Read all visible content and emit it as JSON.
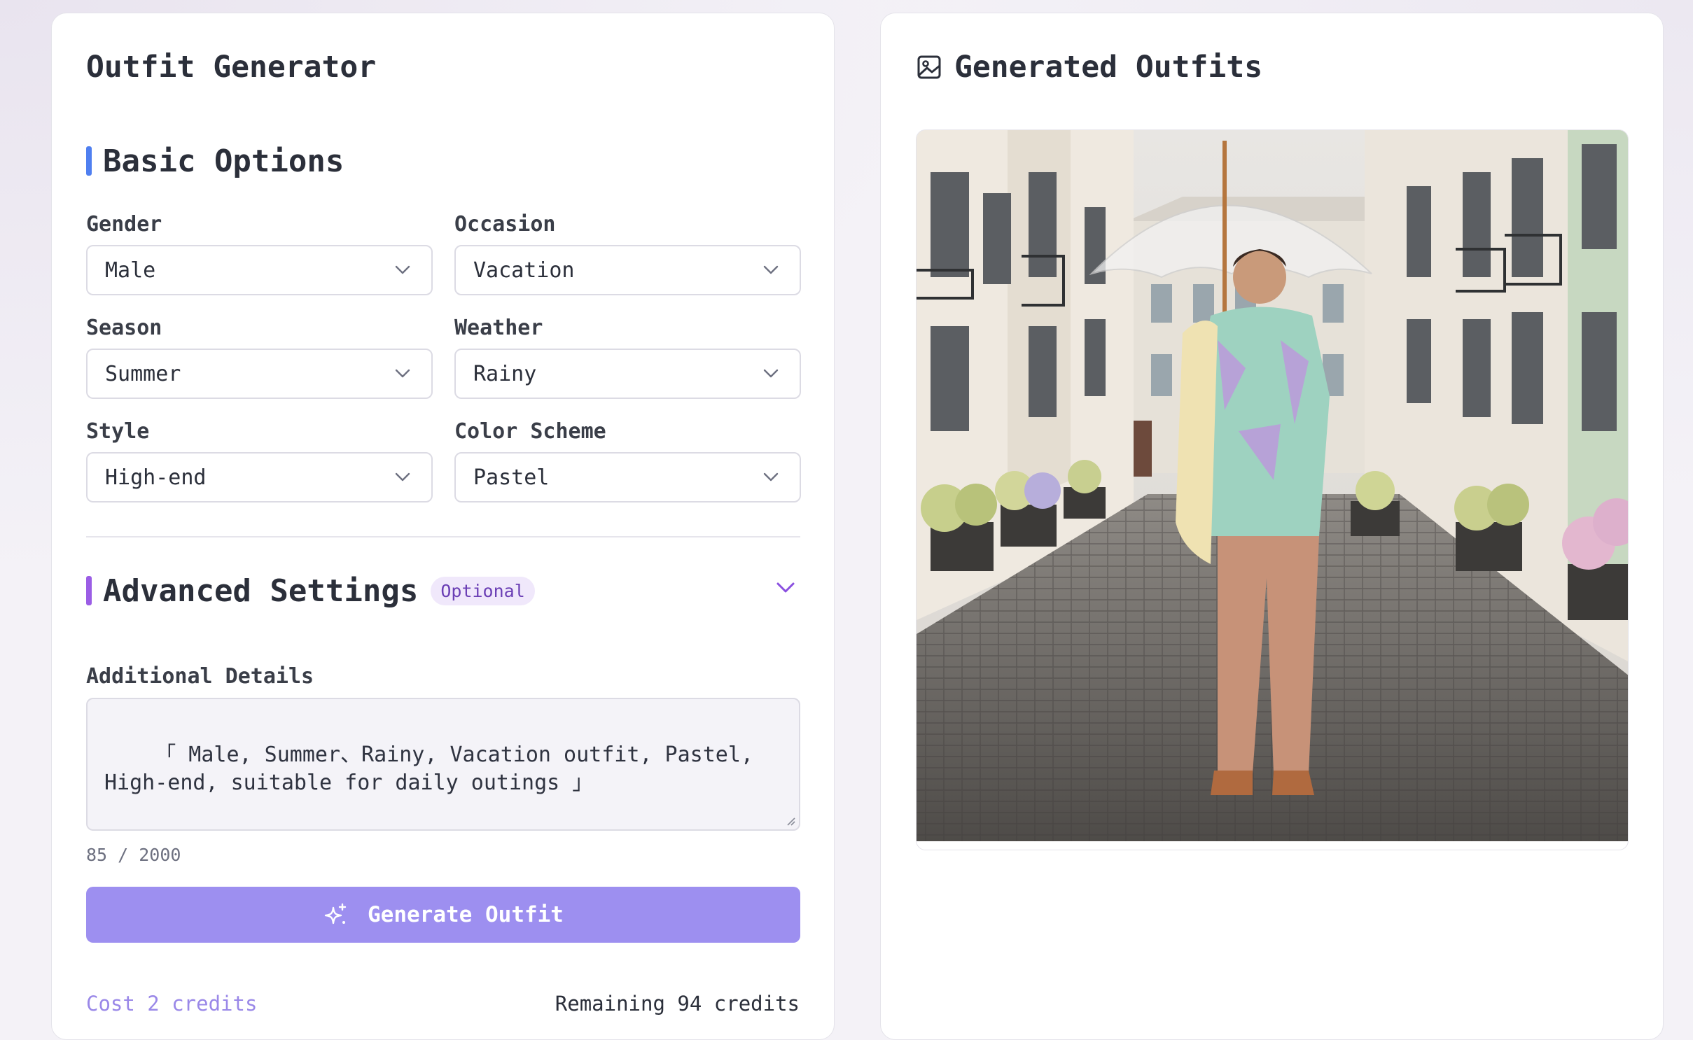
{
  "left_panel": {
    "title": "Outfit Generator",
    "basic_section": {
      "title": "Basic Options",
      "accent_color": "#4f7ff0"
    },
    "fields": {
      "gender": {
        "label": "Gender",
        "value": "Male"
      },
      "occasion": {
        "label": "Occasion",
        "value": "Vacation"
      },
      "season": {
        "label": "Season",
        "value": "Summer"
      },
      "weather": {
        "label": "Weather",
        "value": "Rainy"
      },
      "style": {
        "label": "Style",
        "value": "High-end"
      },
      "color_scheme": {
        "label": "Color Scheme",
        "value": "Pastel"
      }
    },
    "advanced_section": {
      "title": "Advanced Settings",
      "badge": "Optional",
      "accent_color": "#9b5de5"
    },
    "additional_details": {
      "label": "Additional Details",
      "value": "「 Male, Summer、Rainy, Vacation outfit, Pastel, High-end, suitable for daily outings 」",
      "counter": "85 / 2000"
    },
    "generate_button": {
      "label": "Generate Outfit",
      "color": "#9d8ff0"
    },
    "cost_text": "Cost 2 credits",
    "remaining_text": "Remaining 94 credits"
  },
  "right_panel": {
    "title": "Generated Outfits",
    "title_icon": "image-icon",
    "photo_description_icon": "generated-outfit-image"
  }
}
